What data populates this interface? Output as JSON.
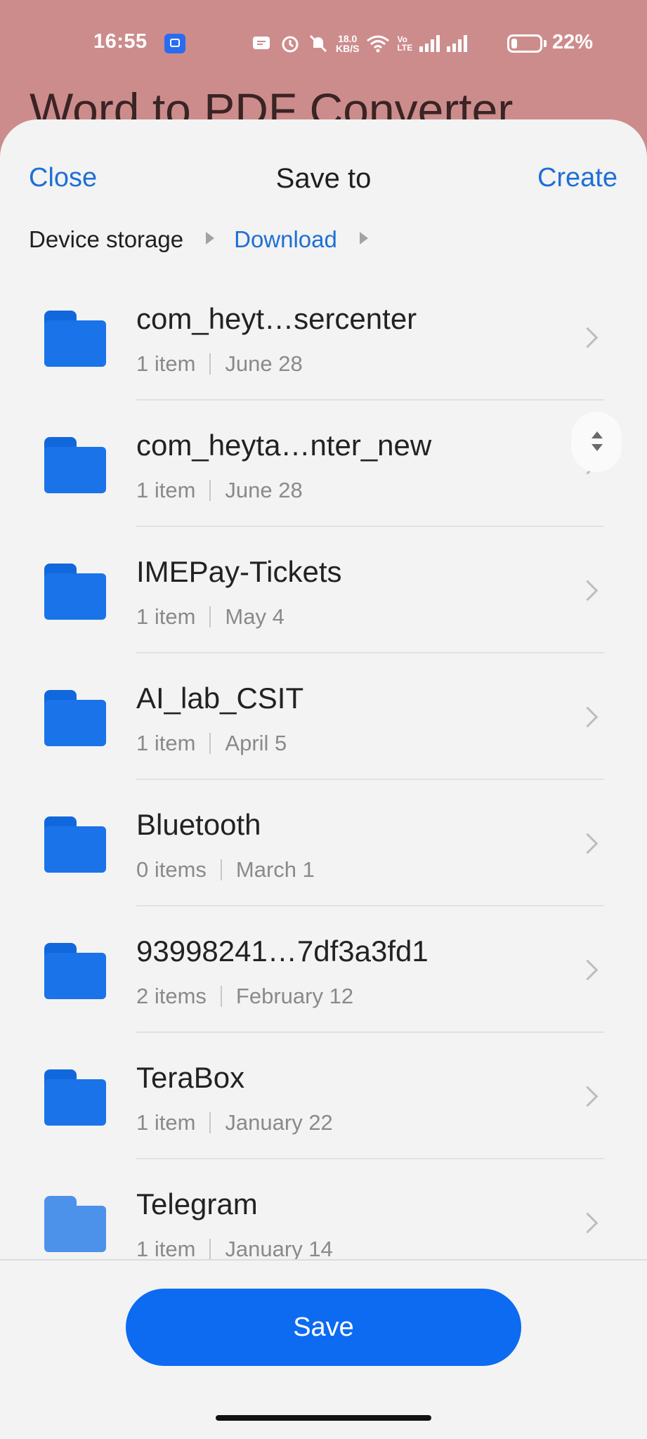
{
  "status_bar": {
    "time": "16:55",
    "network_speed_value": "18.0",
    "network_speed_unit": "KB/S",
    "volte_top": "Vo",
    "volte_bottom": "LTE",
    "battery_percent": "22%",
    "battery_level": 0.22,
    "icons": [
      "app-notification-icon",
      "message-icon",
      "alarm-icon",
      "mute-icon",
      "wifi-icon",
      "volte-icon",
      "signal-icon",
      "signal-icon",
      "battery-icon"
    ]
  },
  "background_app": {
    "title": "Word to PDF Converter"
  },
  "dialog": {
    "close_label": "Close",
    "title": "Save to",
    "create_label": "Create",
    "breadcrumb": {
      "root": "Device storage",
      "current": "Download"
    },
    "folders": [
      {
        "name": "com_heyt…sercenter",
        "count": "1 item",
        "date": "June 28"
      },
      {
        "name": "com_heyta…nter_new",
        "count": "1 item",
        "date": "June 28"
      },
      {
        "name": "IMEPay-Tickets",
        "count": "1 item",
        "date": "May 4"
      },
      {
        "name": "AI_lab_CSIT",
        "count": "1 item",
        "date": "April 5"
      },
      {
        "name": "Bluetooth",
        "count": "0 items",
        "date": "March 1"
      },
      {
        "name": "93998241…7df3a3fd1",
        "count": "2 items",
        "date": "February 12"
      },
      {
        "name": "TeraBox",
        "count": "1 item",
        "date": "January 22"
      },
      {
        "name": "Telegram",
        "count": "1 item",
        "date": "January 14"
      }
    ],
    "save_label": "Save",
    "colors": {
      "accent": "#1e6fd6",
      "save_button": "#0d6bf2",
      "folder": "#1a73e8",
      "background_app": "#cd8c8c"
    }
  }
}
